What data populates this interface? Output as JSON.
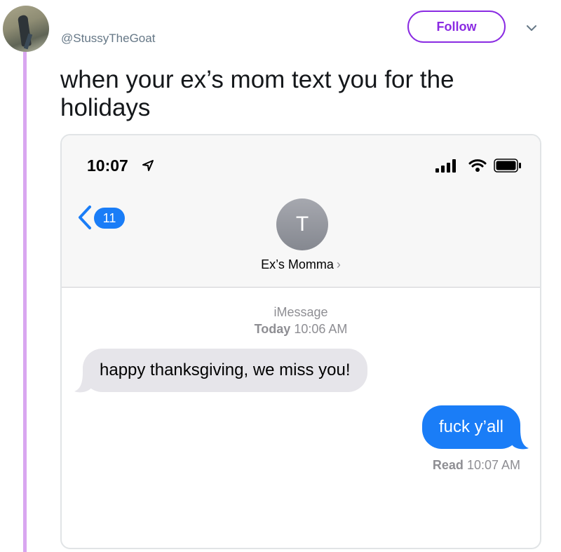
{
  "tweet": {
    "handle": "@StussyTheGoat",
    "follow_label": "Follow",
    "text": "when your ex’s mom text you for the holidays"
  },
  "phone": {
    "status_time": "10:07",
    "back_count": "11",
    "contact_initial": "T",
    "contact_name": "Ex’s Momma",
    "service": "iMessage",
    "timestamp_day": "Today",
    "timestamp_time": "10:06 AM",
    "messages": [
      {
        "direction": "incoming",
        "text": "happy thanksgiving, we miss you!"
      },
      {
        "direction": "outgoing",
        "text": "fuck y’all"
      }
    ],
    "read_label": "Read",
    "read_time": "10:07 AM"
  },
  "colors": {
    "accent_purple": "#8a2be2",
    "thread_line": "#d9a6f0",
    "imessage_blue": "#1a7df7",
    "incoming_bubble": "#e6e5ea"
  }
}
